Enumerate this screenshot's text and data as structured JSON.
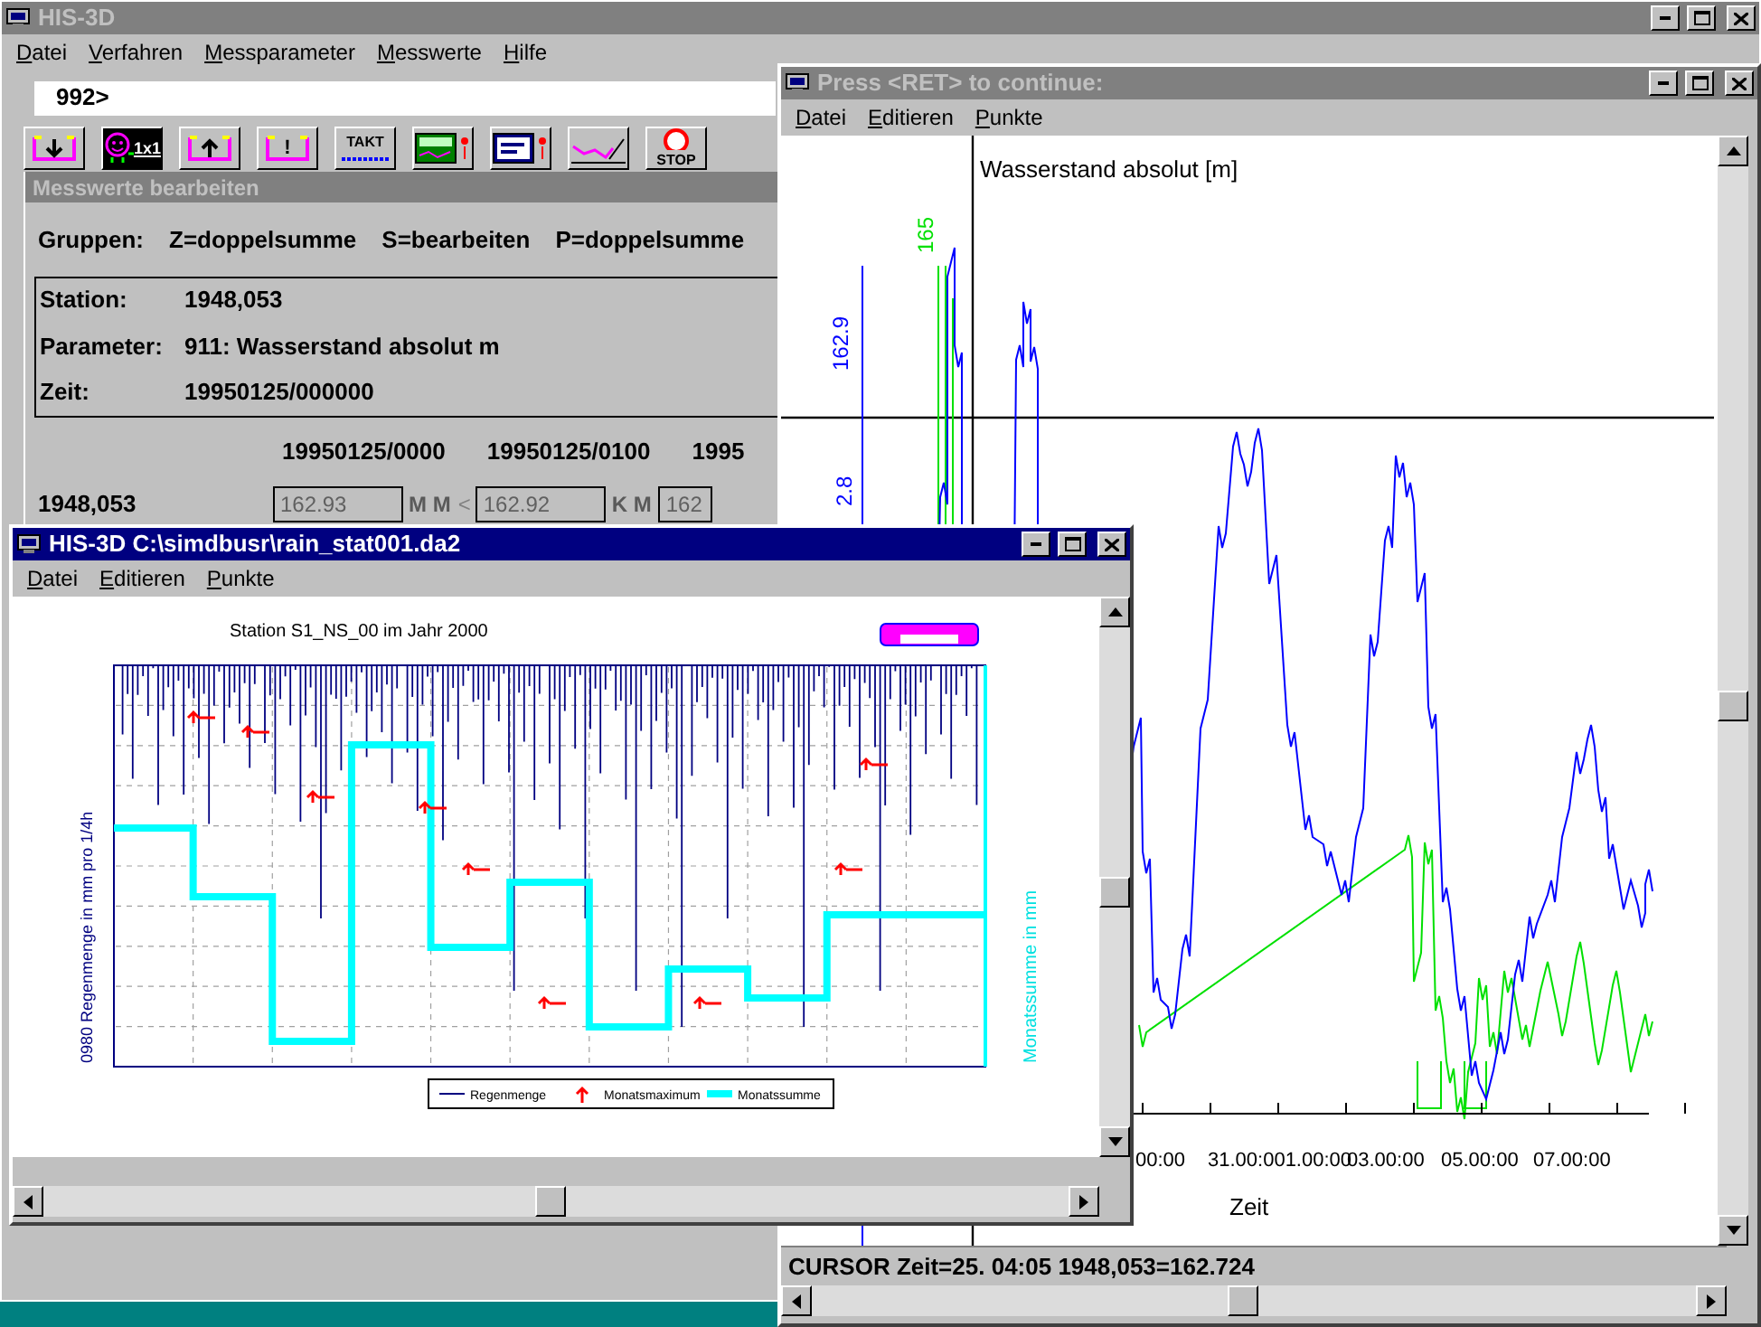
{
  "main_window": {
    "title": "HIS-3D",
    "active": false,
    "menu": [
      "Datei",
      "Verfahren",
      "Messparameter",
      "Messwerte",
      "Hilfe"
    ],
    "command": "992>",
    "toolbar": [
      {
        "kind": "down"
      },
      {
        "kind": "face",
        "label": "1x1"
      },
      {
        "kind": "up"
      },
      {
        "kind": "bang",
        "label": "!"
      },
      {
        "kind": "takt",
        "label": "TAKT"
      },
      {
        "kind": "meter"
      },
      {
        "kind": "panel"
      },
      {
        "kind": "curve"
      },
      {
        "kind": "stop",
        "label": "STOP"
      }
    ],
    "editor": {
      "title": "Messwerte bearbeiten",
      "groups_label": "Gruppen:",
      "groups": [
        "Z=doppelsumme",
        "S=bearbeiten",
        "P=doppelsumme"
      ],
      "info": [
        {
          "label": "Station:",
          "value": "1948,053"
        },
        {
          "label": "Parameter:",
          "value": "911: Wasserstand absolut m"
        },
        {
          "label": "Zeit:",
          "value": "19950125/000000"
        }
      ],
      "columns": [
        "19950125/0000",
        "19950125/0100",
        "1995"
      ],
      "row": {
        "station": "1948,053",
        "cells": [
          {
            "value": "162.93",
            "flag": "M M",
            "disabled": true
          },
          {
            "marker": "<",
            "value": "162.92",
            "flag": "K M",
            "disabled": true
          },
          {
            "value": "162",
            "disabled": true
          }
        ]
      }
    }
  },
  "plot_window": {
    "title": "Press <RET> to continue:",
    "active": false,
    "menu": [
      "Datei",
      "Editieren",
      "Punkte"
    ],
    "chart": {
      "title": "Wasserstand absolut   [m]",
      "labels": [
        {
          "text": "162.9",
          "color": "#0000ff"
        },
        {
          "text": "165",
          "color": "#00e000"
        },
        {
          "text": "2.8",
          "color": "#0000ff"
        }
      ],
      "xticks": [
        "00:00",
        "31.00:001.00:00",
        "03.00:00",
        "05.00:00",
        "07.00:00"
      ],
      "xlabel": "Zeit"
    },
    "status": "CURSOR Zeit=25. 04:05 1948,053=162.724"
  },
  "rain_window": {
    "title": "HIS-3D C:\\simdbusr\\rain_stat001.da2",
    "active": true,
    "menu": [
      "Datei",
      "Editieren",
      "Punkte"
    ],
    "chart": {
      "title": "Station S1_NS_00 im Jahr 2000",
      "ylabel": "0980 Regenmenge in mm pro 1/4h",
      "y2label": "Monatssumme in mm",
      "legend": [
        {
          "kind": "line",
          "label": "Regenmenge"
        },
        {
          "kind": "arrow",
          "label": "Monatsmaximum"
        },
        {
          "kind": "thick",
          "label": "Monatssumme"
        }
      ]
    }
  }
}
